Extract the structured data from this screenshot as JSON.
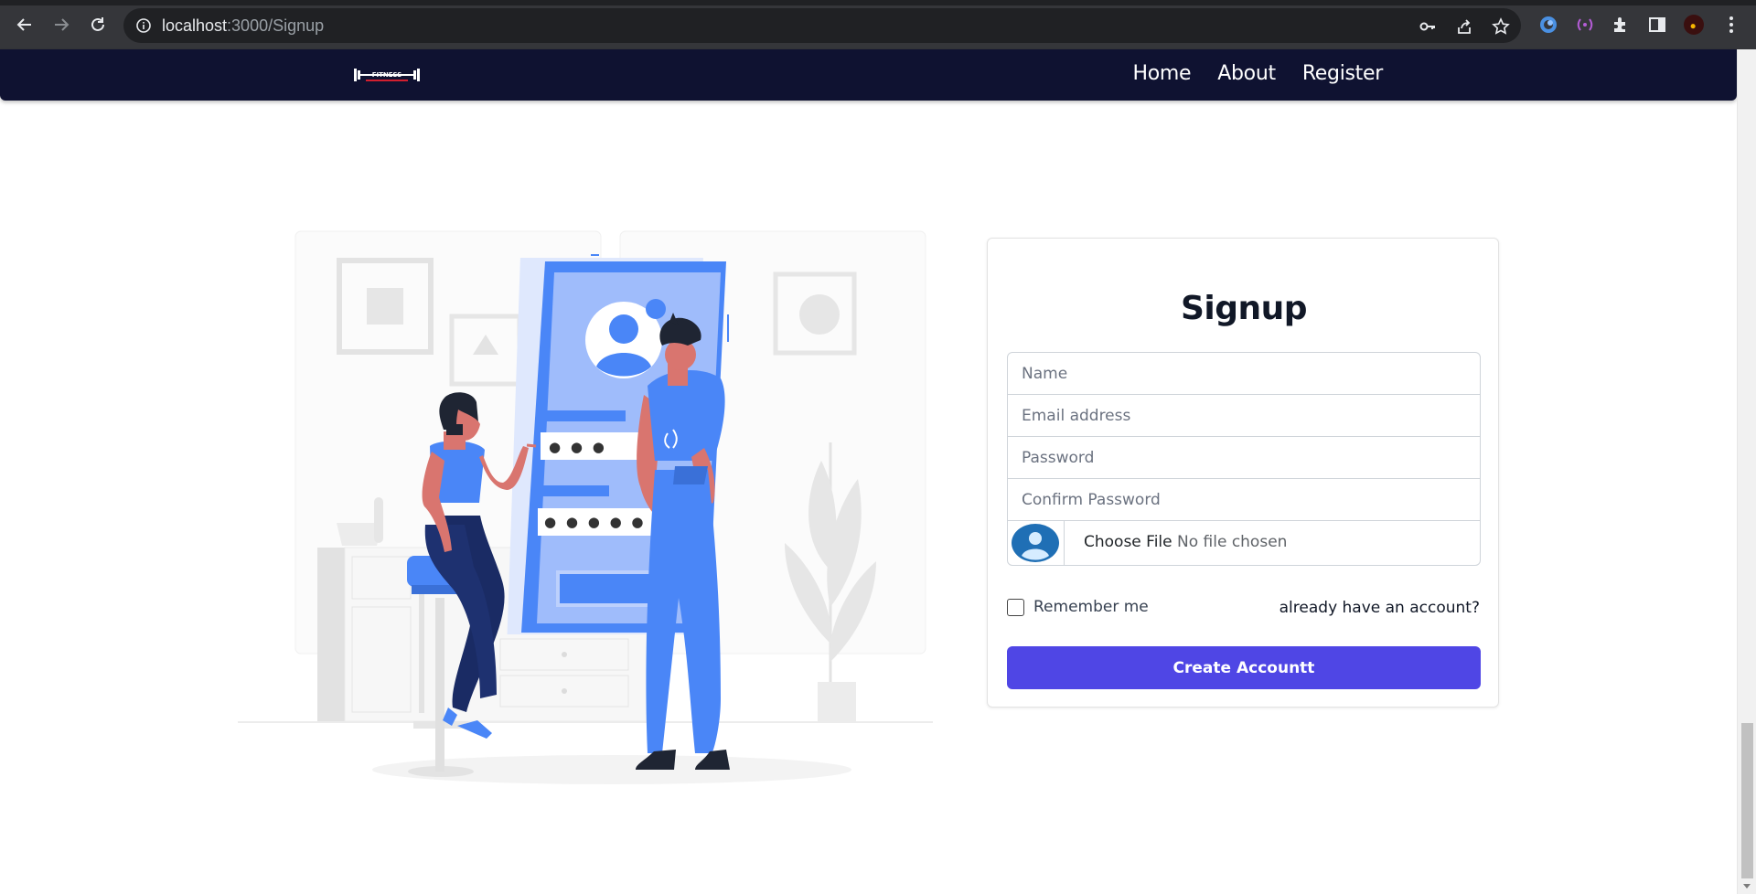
{
  "browser": {
    "url_host": "localhost",
    "url_path": ":3000/Signup"
  },
  "navbar": {
    "brand_text": "FITNESS",
    "links": [
      "Home",
      "About",
      "Register"
    ]
  },
  "illustration": {
    "password_dots_short": "● ● ●",
    "password_dots_long": "● ● ● ● ●"
  },
  "signup": {
    "title": "Signup",
    "name_placeholder": "Name",
    "email_placeholder": "Email address",
    "password_placeholder": "Password",
    "confirm_placeholder": "Confirm Password",
    "choose_file_label": "Choose File",
    "no_file_text": "No file chosen",
    "remember_label": "Remember me",
    "already_link": "already have an account?",
    "submit_label": "Create Accountt"
  },
  "colors": {
    "navbar_bg": "#0f1231",
    "primary_button": "#4f46e5",
    "illustration_blue": "#4a86f7"
  }
}
